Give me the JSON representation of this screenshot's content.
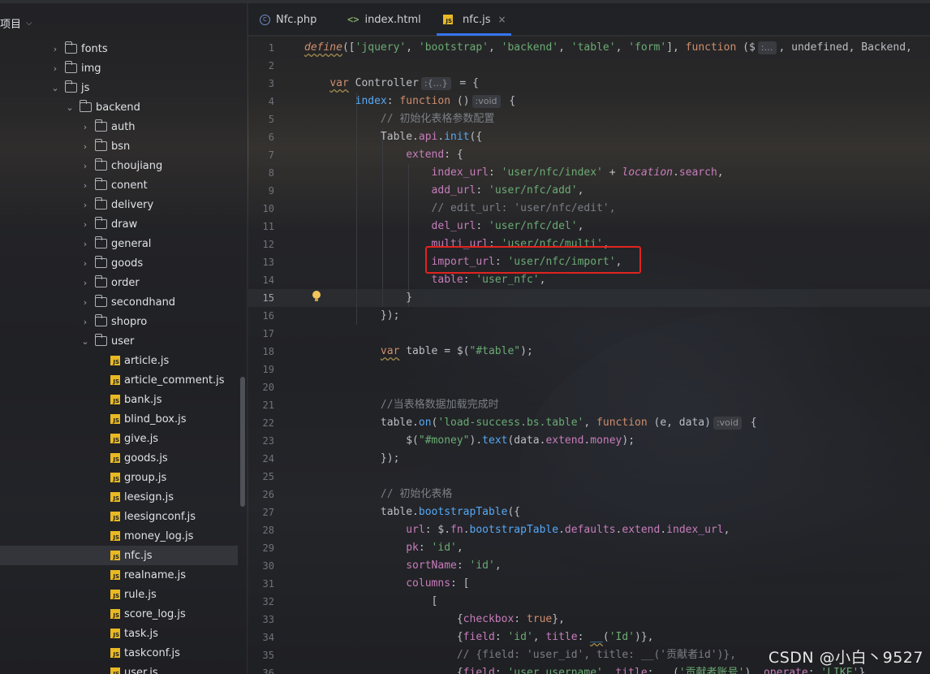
{
  "project": {
    "label": "项目"
  },
  "tree": [
    {
      "label": "fonts",
      "type": "folder",
      "expanded": false
    },
    {
      "label": "img",
      "type": "folder",
      "expanded": false
    },
    {
      "label": "js",
      "type": "folder",
      "expanded": true
    },
    {
      "label": "backend",
      "type": "folder",
      "expanded": true
    },
    {
      "label": "auth",
      "type": "folder",
      "expanded": false
    },
    {
      "label": "bsn",
      "type": "folder",
      "expanded": false
    },
    {
      "label": "choujiang",
      "type": "folder",
      "expanded": false
    },
    {
      "label": "conent",
      "type": "folder",
      "expanded": false
    },
    {
      "label": "delivery",
      "type": "folder",
      "expanded": false
    },
    {
      "label": "draw",
      "type": "folder",
      "expanded": false
    },
    {
      "label": "general",
      "type": "folder",
      "expanded": false
    },
    {
      "label": "goods",
      "type": "folder",
      "expanded": false
    },
    {
      "label": "order",
      "type": "folder",
      "expanded": false
    },
    {
      "label": "secondhand",
      "type": "folder",
      "expanded": false
    },
    {
      "label": "shopro",
      "type": "folder",
      "expanded": false
    },
    {
      "label": "user",
      "type": "folder",
      "expanded": true
    },
    {
      "label": "article.js",
      "type": "js"
    },
    {
      "label": "article_comment.js",
      "type": "js"
    },
    {
      "label": "bank.js",
      "type": "js"
    },
    {
      "label": "blind_box.js",
      "type": "js"
    },
    {
      "label": "give.js",
      "type": "js"
    },
    {
      "label": "goods.js",
      "type": "js"
    },
    {
      "label": "group.js",
      "type": "js"
    },
    {
      "label": "leesign.js",
      "type": "js"
    },
    {
      "label": "leesignconf.js",
      "type": "js"
    },
    {
      "label": "money_log.js",
      "type": "js"
    },
    {
      "label": "nfc.js",
      "type": "js",
      "selected": true
    },
    {
      "label": "realname.js",
      "type": "js"
    },
    {
      "label": "rule.js",
      "type": "js"
    },
    {
      "label": "score_log.js",
      "type": "js"
    },
    {
      "label": "task.js",
      "type": "js"
    },
    {
      "label": "taskconf.js",
      "type": "js"
    },
    {
      "label": "user.js",
      "type": "js"
    }
  ],
  "tabs": [
    {
      "label": "Nfc.php",
      "icon": "php-icon"
    },
    {
      "label": "index.html",
      "icon": "html-icon"
    },
    {
      "label": "nfc.js",
      "icon": "js-icon",
      "active": true,
      "close": "×"
    }
  ],
  "js_badge": "JS",
  "html_glyph": "<>",
  "php_glyph": "C",
  "current_line": 15,
  "code_lines": [
    {
      "n": "1",
      "html": "<span class=\"kw ital ul\">define</span>([<span class=\"str\">'jquery'</span>, <span class=\"str\">'bootstrap'</span>, <span class=\"str\">'backend'</span>, <span class=\"str\">'table'</span>, <span class=\"str\">'form'</span>], <span class=\"kw\">function</span> ($<span class=\"hint\">:…</span>, undefined, Backend,"
    },
    {
      "n": "2",
      "html": ""
    },
    {
      "n": "3",
      "html": "    <span class=\"kw ul\">var</span> Controller<span class=\"hint\">:{…}</span> = {"
    },
    {
      "n": "4",
      "html": "        <span class=\"fn\">index</span>: <span class=\"kw\">function</span> ()<span class=\"hint\">:void</span> {"
    },
    {
      "n": "5",
      "html": "            <span class=\"cm\">// 初始化表格参数配置</span>"
    },
    {
      "n": "6",
      "html": "            Table.<span class=\"prop\">api</span>.<span class=\"fn\">init</span>({"
    },
    {
      "n": "7",
      "html": "                <span class=\"prop\">extend</span>: {"
    },
    {
      "n": "8",
      "html": "                    <span class=\"prop\">index_url</span>: <span class=\"str\">'user/nfc/index'</span> + <span class=\"prop ital\">location</span>.<span class=\"prop\">search</span>,"
    },
    {
      "n": "9",
      "html": "                    <span class=\"prop\">add_url</span>: <span class=\"str\">'user/nfc/add'</span>,"
    },
    {
      "n": "10",
      "html": "                    <span class=\"cm\">// edit_url: 'user/nfc/edit',</span>"
    },
    {
      "n": "11",
      "html": "                    <span class=\"prop\">del_url</span>: <span class=\"str\">'user/nfc/del'</span>,"
    },
    {
      "n": "12",
      "html": "                    <span class=\"prop\">multi_url</span>: <span class=\"str\">'user/nfc/multi'</span>,"
    },
    {
      "n": "13",
      "html": "                    <span class=\"prop\">import_url</span>: <span class=\"str\">'user/nfc/import'</span>,"
    },
    {
      "n": "14",
      "html": "                    <span class=\"prop\">table</span>: <span class=\"str\">'user_nfc'</span>,"
    },
    {
      "n": "15",
      "html": "                }"
    },
    {
      "n": "16",
      "html": "            });"
    },
    {
      "n": "17",
      "html": ""
    },
    {
      "n": "18",
      "html": "            <span class=\"kw ul\">var</span> table = $(<span class=\"str\">\"#table\"</span>);"
    },
    {
      "n": "19",
      "html": ""
    },
    {
      "n": "20",
      "html": ""
    },
    {
      "n": "21",
      "html": "            <span class=\"cm\">//当表格数据加载完成时</span>"
    },
    {
      "n": "22",
      "html": "            table.<span class=\"fn\">on</span>(<span class=\"str\">'load-success.bs.table'</span>, <span class=\"kw\">function</span> (e, data)<span class=\"hint\">:void</span> {"
    },
    {
      "n": "23",
      "html": "                $(<span class=\"str\">\"#money\"</span>).<span class=\"fn\">text</span>(data.<span class=\"prop\">extend</span>.<span class=\"prop\">money</span>);"
    },
    {
      "n": "24",
      "html": "            });"
    },
    {
      "n": "25",
      "html": ""
    },
    {
      "n": "26",
      "html": "            <span class=\"cm\">// 初始化表格</span>"
    },
    {
      "n": "27",
      "html": "            table.<span class=\"fn\">bootstrapTable</span>({"
    },
    {
      "n": "28",
      "html": "                <span class=\"prop\">url</span>: $.<span class=\"prop\">fn</span>.<span class=\"fn\">bootstrapTable</span>.<span class=\"prop\">defaults</span>.<span class=\"prop\">extend</span>.<span class=\"prop\">index_url</span>,"
    },
    {
      "n": "29",
      "html": "                <span class=\"prop\">pk</span>: <span class=\"str\">'id'</span>,"
    },
    {
      "n": "30",
      "html": "                <span class=\"prop\">sortName</span>: <span class=\"str\">'id'</span>,"
    },
    {
      "n": "31",
      "html": "                <span class=\"prop\">columns</span>: ["
    },
    {
      "n": "32",
      "html": "                    ["
    },
    {
      "n": "33",
      "html": "                        {<span class=\"prop\">checkbox</span>: <span class=\"kw\">true</span>},"
    },
    {
      "n": "34",
      "html": "                        {<span class=\"prop\">field</span>: <span class=\"str\">'id'</span>, <span class=\"prop\">title</span>: <span class=\"fn ul\">__</span>(<span class=\"str\">'Id'</span>)},"
    },
    {
      "n": "35",
      "html": "                        <span class=\"cm\">// {field: 'user_id', title: __('贡献者id')},</span>"
    },
    {
      "n": "36",
      "html": "                        {<span class=\"prop\">field</span>: <span class=\"str\">'user.username'</span>, <span class=\"prop\">title</span>: <span class=\"fn\">__</span>(<span class=\"str\">'贡献者账号'</span>), <span class=\"prop\">operate</span>: <span class=\"str\">'LIKE'</span>},"
    }
  ],
  "watermark": "CSDN @小白丶9527",
  "colors": {
    "accent": "#3574f0",
    "highlight_box": "#e0241f",
    "string": "#6aab73",
    "keyword": "#cf8e6d"
  }
}
